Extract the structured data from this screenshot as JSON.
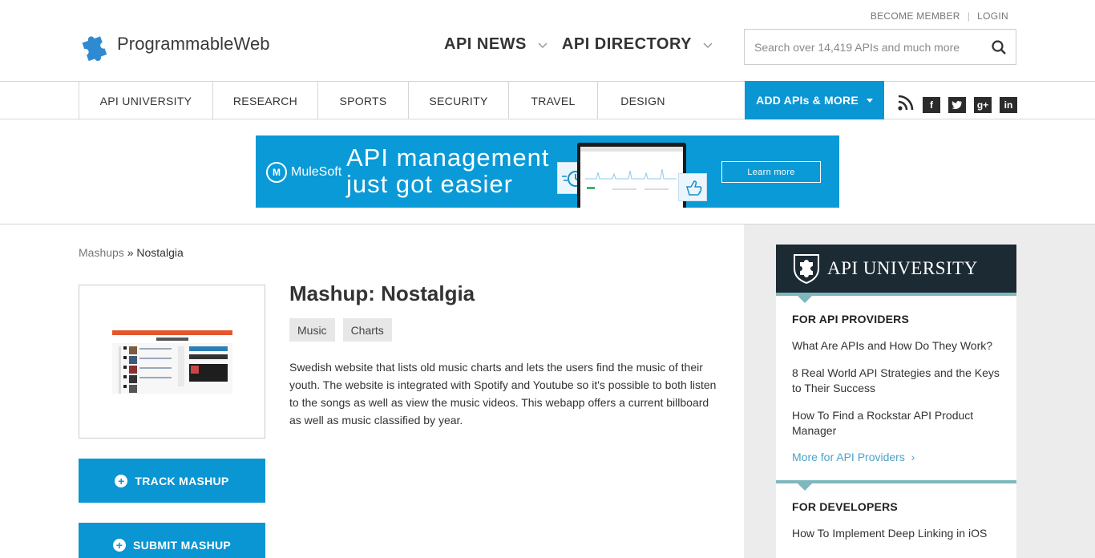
{
  "header": {
    "logo_text": "ProgrammableWeb",
    "become_member": "BECOME MEMBER",
    "login": "LOGIN",
    "nav": [
      {
        "label": "API NEWS"
      },
      {
        "label": "API DIRECTORY"
      }
    ],
    "search_placeholder": "Search over 14,419 APIs and much more"
  },
  "subnav": {
    "categories": [
      "API UNIVERSITY",
      "RESEARCH",
      "SPORTS",
      "SECURITY",
      "TRAVEL",
      "DESIGN"
    ],
    "add_label": "ADD APIs & MORE",
    "social": [
      "rss-icon",
      "facebook-icon",
      "twitter-icon",
      "google-plus-icon",
      "linkedin-icon"
    ]
  },
  "banner": {
    "brand": "MuleSoft",
    "line1": "API management",
    "line2": "just got easier",
    "cta": "Learn more"
  },
  "breadcrumb": {
    "parent": "Mashups",
    "separator": "»",
    "current": "Nostalgia"
  },
  "mashup": {
    "title": "Mashup: Nostalgia",
    "tags": [
      "Music",
      "Charts"
    ],
    "description": "Swedish website that lists old music charts and lets the users find the music of their youth. The website is integrated with Spotify and Youtube so it's possible to both listen to the songs as well as view the music videos. This webapp offers a current billboard as well as music classified by year.",
    "track_label": "TRACK MASHUP",
    "submit_label": "SUBMIT MASHUP"
  },
  "university": {
    "title": "API UNIVERSITY",
    "providers_title": "FOR API PROVIDERS",
    "providers_links": [
      "What Are APIs and How Do They Work?",
      "8 Real World API Strategies and the Keys to Their Success",
      "How To Find a Rockstar API Product Manager"
    ],
    "providers_more": "More for API Providers",
    "developers_title": "FOR DEVELOPERS",
    "developers_links": [
      "How To Implement Deep Linking in iOS"
    ]
  },
  "colors": {
    "accent": "#0a95d3",
    "university_head": "#1c2a33",
    "university_bar": "#7fb7bf"
  }
}
